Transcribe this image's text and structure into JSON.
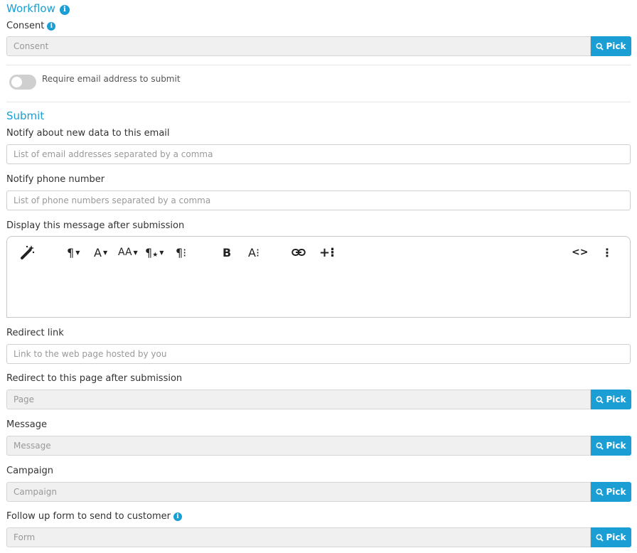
{
  "workflow": {
    "title": "Workflow",
    "info_icon": "info-icon"
  },
  "consent": {
    "label": "Consent",
    "placeholder": "Consent",
    "pick_label": "Pick"
  },
  "require_email": {
    "label": "Require email address to submit",
    "enabled": false
  },
  "submit": {
    "title": "Submit"
  },
  "notify_email": {
    "label": "Notify about new data to this email",
    "placeholder": "List of email addresses separated by a comma"
  },
  "notify_phone": {
    "label": "Notify phone number",
    "placeholder": "List of phone numbers separated by a comma"
  },
  "display_message": {
    "label": "Display this message after submission",
    "toolbar": {
      "paragraph": "¶",
      "font": "A",
      "font_size": "AA",
      "paragraph_style": "¶",
      "paragraph_more": "¶⁝",
      "bold": "B",
      "text_more": "A⁝",
      "insert_more": "+⁝",
      "code_view": "<>",
      "more": "⋮"
    }
  },
  "redirect_link": {
    "label": "Redirect link",
    "placeholder": "Link to the web page hosted by you"
  },
  "redirect_page": {
    "label": "Redirect to this page after submission",
    "placeholder": "Page",
    "pick_label": "Pick"
  },
  "message": {
    "label": "Message",
    "placeholder": "Message",
    "pick_label": "Pick"
  },
  "campaign": {
    "label": "Campaign",
    "placeholder": "Campaign",
    "pick_label": "Pick"
  },
  "followup": {
    "label": "Follow up form to send to customer",
    "placeholder": "Form",
    "pick_label": "Pick"
  },
  "colors": {
    "accent": "#1a9ed4",
    "field_bg": "#f0f0f0"
  }
}
